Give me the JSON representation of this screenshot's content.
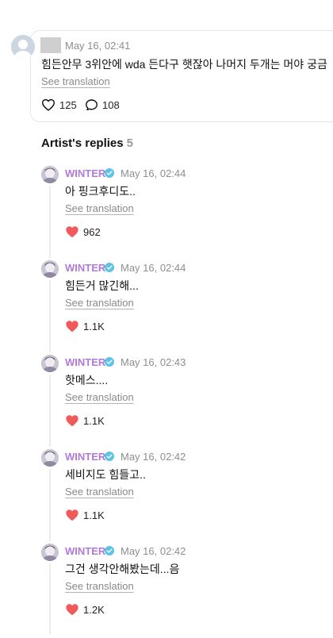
{
  "post": {
    "timestamp": "May 16, 02:41",
    "text": "힘든안무 3위안에 wda 든다구 햇잖아 나머지 두개는 머야 궁금",
    "see_translation": "See translation",
    "likes": "125",
    "comments": "108"
  },
  "replies_section": {
    "title": "Artist's replies",
    "count": "5"
  },
  "replies": [
    {
      "author": "WINTER",
      "timestamp": "May 16, 02:44",
      "text": "아 핑크후디도..",
      "see_translation": "See translation",
      "likes": "962"
    },
    {
      "author": "WINTER",
      "timestamp": "May 16, 02:44",
      "text": "힘든거 많긴해...",
      "see_translation": "See translation",
      "likes": "1.1K"
    },
    {
      "author": "WINTER",
      "timestamp": "May 16, 02:43",
      "text": "핫메스....",
      "see_translation": "See translation",
      "likes": "1.1K"
    },
    {
      "author": "WINTER",
      "timestamp": "May 16, 02:42",
      "text": "세비지도 힘들고..",
      "see_translation": "See translation",
      "likes": "1.1K"
    },
    {
      "author": "WINTER",
      "timestamp": "May 16, 02:42",
      "text": "그건 생각안해봤는데...음",
      "see_translation": "See translation",
      "likes": "1.2K"
    }
  ],
  "colors": {
    "artist_name": "#b07ad9",
    "verified_badge": "#5fc3e4",
    "liked_heart": "#f15a5a",
    "muted_text": "#8e8e8e"
  },
  "icons": {
    "like": "heart-outline-icon",
    "comment": "speech-bubble-icon",
    "verified": "verified-badge-icon",
    "liked": "heart-filled-icon"
  }
}
